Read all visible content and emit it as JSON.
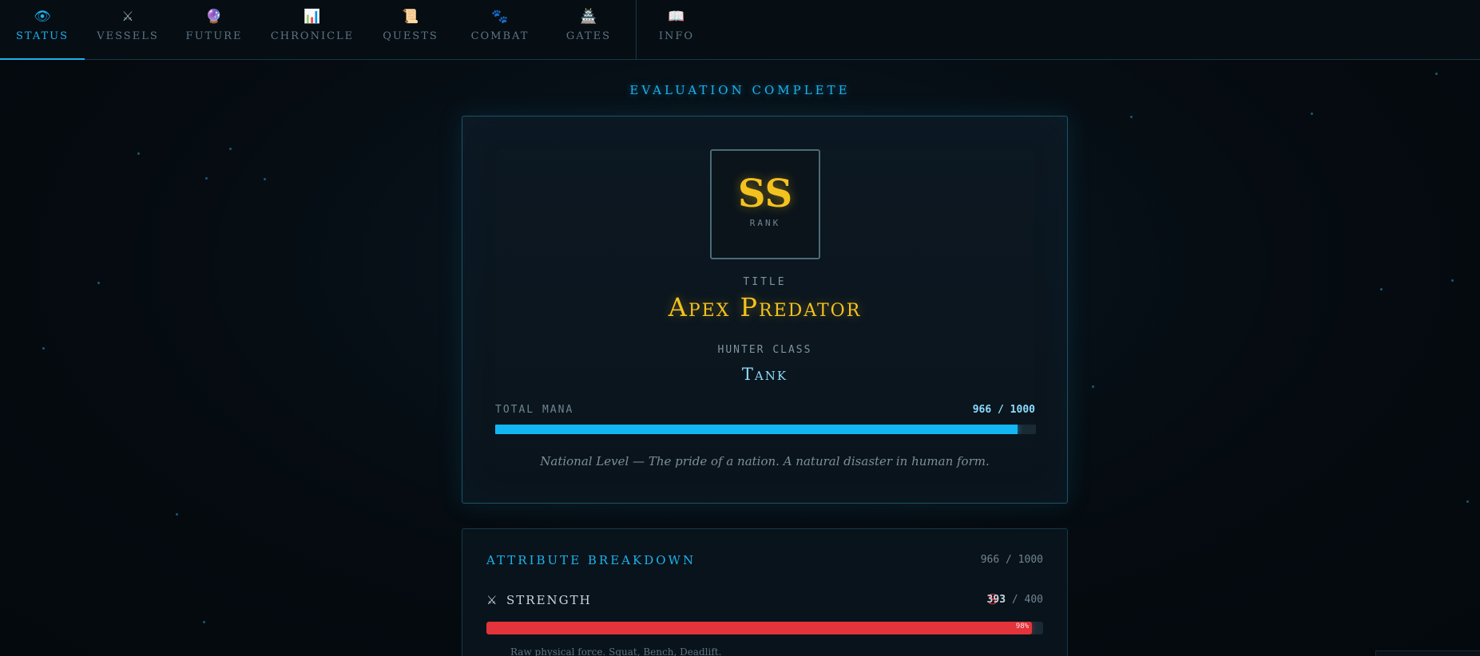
{
  "nav": {
    "tabs": [
      {
        "label": "STATUS",
        "icon": "👁",
        "icon_name": "eye-icon",
        "active": true
      },
      {
        "label": "VESSELS",
        "icon": "⚔",
        "icon_name": "crossed-swords-icon"
      },
      {
        "label": "FUTURE",
        "icon": "🔮",
        "icon_name": "crystal-ball-icon"
      },
      {
        "label": "CHRONICLE",
        "icon": "📊",
        "icon_name": "bar-chart-icon"
      },
      {
        "label": "QUESTS",
        "icon": "📜",
        "icon_name": "scroll-icon"
      },
      {
        "label": "COMBAT",
        "icon": "🐾",
        "icon_name": "paw-prints-icon"
      },
      {
        "label": "GATES",
        "icon": "🏯",
        "icon_name": "gate-icon"
      },
      {
        "label": "INFO",
        "icon": "📖",
        "icon_name": "book-icon"
      }
    ]
  },
  "header": {
    "status": "EVALUATION COMPLETE"
  },
  "evaluation": {
    "rank": "SS",
    "rank_label": "RANK",
    "title_label": "TITLE",
    "title": "Apex Predator",
    "class_label": "HUNTER CLASS",
    "class": "Tank",
    "mana_label": "TOTAL MANA",
    "mana_text": "966 / 1000",
    "mana_fraction": 0.966,
    "tagline": "National Level — The pride of a nation. A natural disaster in human form."
  },
  "attributes": {
    "title": "ATTRIBUTE BREAKDOWN",
    "total": "966 / 1000",
    "strength": {
      "icon": "⚔",
      "icon_name": "crossed-swords-icon",
      "label": "STRENGTH",
      "grade": "S",
      "value": "393",
      "max": "/ 400",
      "percent_text": "98%",
      "fraction": 0.98,
      "description": "Raw physical force. Squat, Bench, Deadlift."
    }
  },
  "colors": {
    "accent": "#1bb3ee",
    "gold": "#f4c21f",
    "mana": "#12b6f2",
    "strength": "#e2343a"
  }
}
